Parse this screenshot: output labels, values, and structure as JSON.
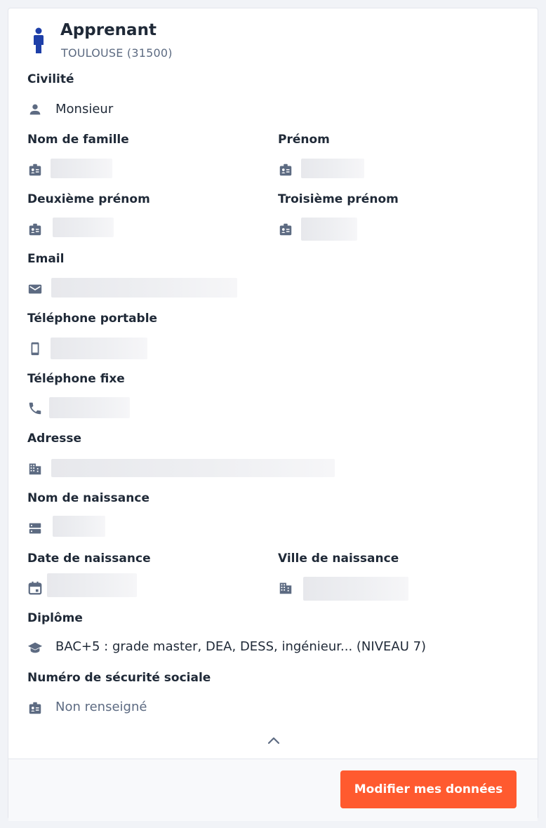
{
  "header": {
    "title": "Apprenant",
    "subtitle": "TOULOUSE (31500)"
  },
  "fields": {
    "civilite": {
      "label": "Civilité",
      "value": "Monsieur",
      "icon": "person-icon"
    },
    "nom": {
      "label": "Nom de famille",
      "icon": "badge-icon"
    },
    "prenom": {
      "label": "Prénom",
      "icon": "badge-icon"
    },
    "deuxieme_prenom": {
      "label": "Deuxième prénom",
      "icon": "badge-icon"
    },
    "troisieme_prenom": {
      "label": "Troisième prénom",
      "icon": "badge-icon"
    },
    "email": {
      "label": "Email",
      "icon": "mail-icon"
    },
    "tel_portable": {
      "label": "Téléphone portable",
      "icon": "smartphone-icon"
    },
    "tel_fixe": {
      "label": "Téléphone fixe",
      "icon": "phone-icon"
    },
    "adresse": {
      "label": "Adresse",
      "icon": "building-icon"
    },
    "nom_naissance": {
      "label": "Nom de naissance",
      "icon": "storage-icon"
    },
    "date_naissance": {
      "label": "Date de naissance",
      "icon": "calendar-icon"
    },
    "ville_naissance": {
      "label": "Ville de naissance",
      "icon": "building-icon"
    },
    "diplome": {
      "label": "Diplôme",
      "value": "BAC+5 : grade master, DEA, DESS, ingénieur... (NIVEAU 7)",
      "icon": "graduation-cap-icon"
    },
    "secu": {
      "label": "Numéro de sécurité sociale",
      "value": "Non renseigné",
      "icon": "badge-icon"
    }
  },
  "footer": {
    "button_label": "Modifier mes données"
  },
  "colors": {
    "accent": "#ff5a2f",
    "person_icon": "#1e3fa8",
    "icon": "#5d6b82",
    "muted_text": "#5d6b82"
  }
}
